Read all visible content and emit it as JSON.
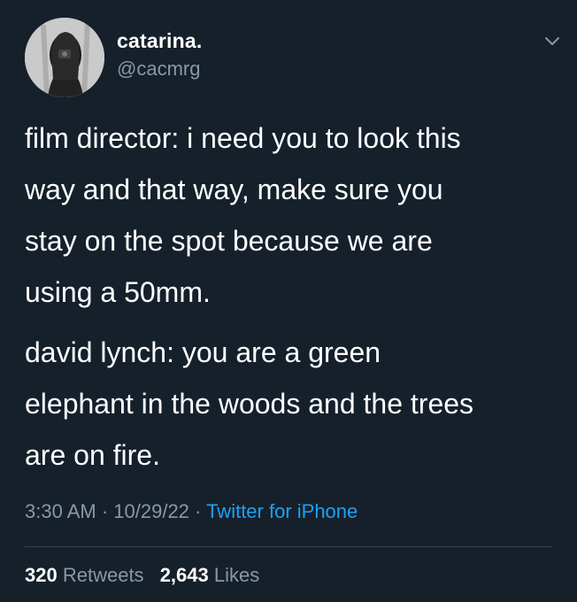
{
  "user": {
    "display_name": "catarina.",
    "handle": "@cacmrg"
  },
  "header": {
    "menu_icon": "chevron-down-icon"
  },
  "tweet": {
    "paragraphs": [
      "film director: i need you to look this\nway and that way, make sure you\nstay on the spot because we are\nusing a 50mm.",
      "david lynch: you are a green\nelephant in the woods and the trees\nare on fire."
    ]
  },
  "meta": {
    "time": "3:30 AM",
    "separator": " · ",
    "date": "10/29/22",
    "source": "Twitter for iPhone"
  },
  "stats": {
    "retweets_count": "320",
    "retweets_label": "Retweets",
    "likes_count": "2,643",
    "likes_label": "Likes"
  },
  "colors": {
    "background": "#15202b",
    "text_primary": "#ffffff",
    "text_secondary": "#8899a6",
    "link": "#1da1f2",
    "divider": "#38444d"
  }
}
